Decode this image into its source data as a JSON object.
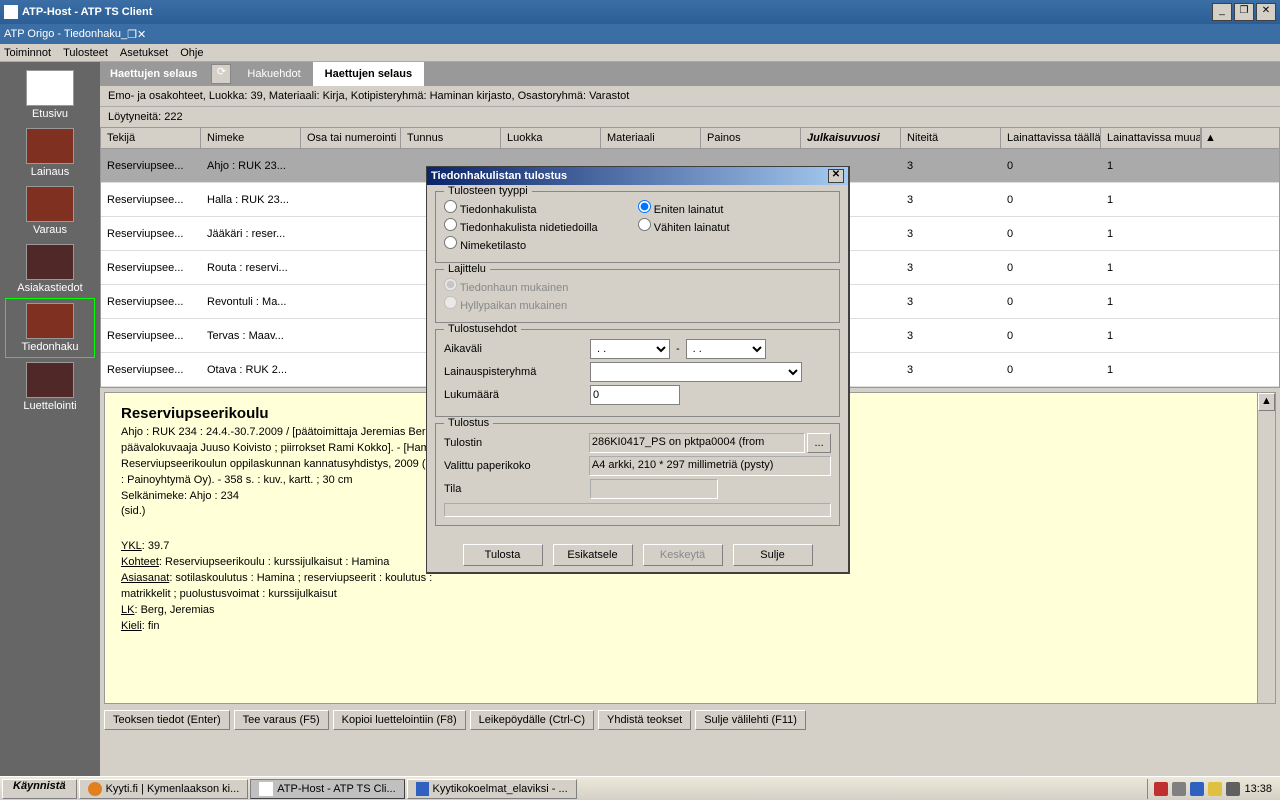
{
  "outer_title": "ATP-Host - ATP TS Client",
  "inner_title": "ATP Origo - Tiedonhaku",
  "menus": [
    "Toiminnot",
    "Tulosteet",
    "Asetukset",
    "Ohje"
  ],
  "sidebar": [
    {
      "label": "Etusivu"
    },
    {
      "label": "Lainaus"
    },
    {
      "label": "Varaus"
    },
    {
      "label": "Asiakastiedot"
    },
    {
      "label": "Tiedonhaku"
    },
    {
      "label": "Luettelointi"
    }
  ],
  "tabs": {
    "section": "Haettujen selaus",
    "hakuehdot": "Hakuehdot",
    "haettujen": "Haettujen selaus"
  },
  "breadcrumb": "Emo- ja osakohteet, Luokka:  39, Materiaali:  Kirja, Kotipisteryhmä:  Haminan kirjasto, Osastoryhmä:  Varastot",
  "result_count": "Löytyneitä:  222",
  "columns": [
    "Tekijä",
    "Nimeke",
    "Osa tai numerointi",
    "Tunnus",
    "Luokka",
    "Materiaali",
    "Painos",
    "Julkaisuvuosi",
    "Niteitä",
    "Lainattavissa täällä",
    "Lainattavissa muualla"
  ],
  "rows": [
    {
      "tekija": "Reserviupsee...",
      "nimeke": "Ahjo : RUK 23...",
      "niteita": "3",
      "taalla": "0",
      "muualla": "1",
      "sel": true
    },
    {
      "tekija": "Reserviupsee...",
      "nimeke": "Halla : RUK 23...",
      "niteita": "3",
      "taalla": "0",
      "muualla": "1"
    },
    {
      "tekija": "Reserviupsee...",
      "nimeke": "Jääkäri : reser...",
      "niteita": "3",
      "taalla": "0",
      "muualla": "1"
    },
    {
      "tekija": "Reserviupsee...",
      "nimeke": "Routa : reservi...",
      "niteita": "3",
      "taalla": "0",
      "muualla": "1"
    },
    {
      "tekija": "Reserviupsee...",
      "nimeke": "Revontuli : Ma...",
      "niteita": "3",
      "taalla": "0",
      "muualla": "1"
    },
    {
      "tekija": "Reserviupsee...",
      "nimeke": "Tervas : Maav...",
      "niteita": "3",
      "taalla": "0",
      "muualla": "1"
    },
    {
      "tekija": "Reserviupsee...",
      "nimeke": "Otava : RUK 2...",
      "niteita": "3",
      "taalla": "0",
      "muualla": "1"
    }
  ],
  "detail": {
    "title": "Reserviupseerikoulu",
    "body1": "Ahjo : RUK 234 : 24.4.-30.7.2009 / [päätoimittaja Jeremias Berg ; päävalokuvaaja Juuso Koivisto ; piirrokset Rami Kokko]. - [Hamina] : Reserviupseerikoulun oppilaskunnan kannatusyhdistys, 2009 (Porvoo : Painoyhtymä Oy). - 358 s. : kuv., kartt. ; 30 cm",
    "body2": "Selkänimeke: Ahjo : 234",
    "body3": "(sid.)",
    "ykl_label": "YKL",
    "ykl": ": 39.7",
    "kohteet_label": "Kohteet",
    "kohteet": ": Reserviupseerikoulu : kurssijulkaisut : Hamina",
    "asiasanat_label": "Asiasanat",
    "asiasanat": ": sotilaskoulutus : Hamina ; reserviupseerit : koulutus : matrikkelit ; puolustusvoimat : kurssijulkaisut",
    "lk_label": "LK",
    "lk": ": Berg, Jeremias",
    "kieli_label": "Kieli",
    "kieli": ": fin"
  },
  "bottom_tabs": [
    "Teoksen tiedot (Enter)",
    "Tee varaus (F5)",
    "Kopioi luettelointiin (F8)",
    "Leikepöydälle (Ctrl-C)",
    "Yhdistä teokset",
    "Sulje välilehti (F11)"
  ],
  "dialog": {
    "title": "Tiedonhakulistan tulostus",
    "group_type": "Tulosteen tyyppi",
    "radios_left": [
      "Tiedonhakulista",
      "Tiedonhakulista nidetiedoilla",
      "Nimeketilasto"
    ],
    "radios_right": [
      "Eniten lainatut",
      "Vähiten lainatut"
    ],
    "group_sort": "Lajittelu",
    "sort_radios": [
      "Tiedonhaun mukainen",
      "Hyllypaikan mukainen"
    ],
    "group_cond": "Tulostusehdot",
    "aikavali": "Aikaväli",
    "lainauspiste": "Lainauspisteryhmä",
    "lukumaara_label": "Lukumäärä",
    "lukumaara_val": "0",
    "date_placeholder": ".  .",
    "dash": "-",
    "group_print": "Tulostus",
    "tulostin_label": "Tulostin",
    "tulostin_val": "286KI0417_PS on pktpa0004 (from ",
    "paperi_label": "Valittu paperikoko",
    "paperi_val": " A4 arkki, 210 * 297 millimetriä (pysty)",
    "tila_label": "Tila",
    "btn_tulosta": "Tulosta",
    "btn_esikatsele": "Esikatsele",
    "btn_keskeyta": "Keskeytä",
    "btn_sulje": "Sulje",
    "ellipsis": "..."
  },
  "taskbar": {
    "start": "Käynnistä",
    "tasks": [
      "Kyyti.fi | Kymenlaakson ki...",
      "ATP-Host - ATP TS Cli...",
      "Kyytikokoelmat_elaviksi - ..."
    ],
    "clock": "13:38"
  }
}
